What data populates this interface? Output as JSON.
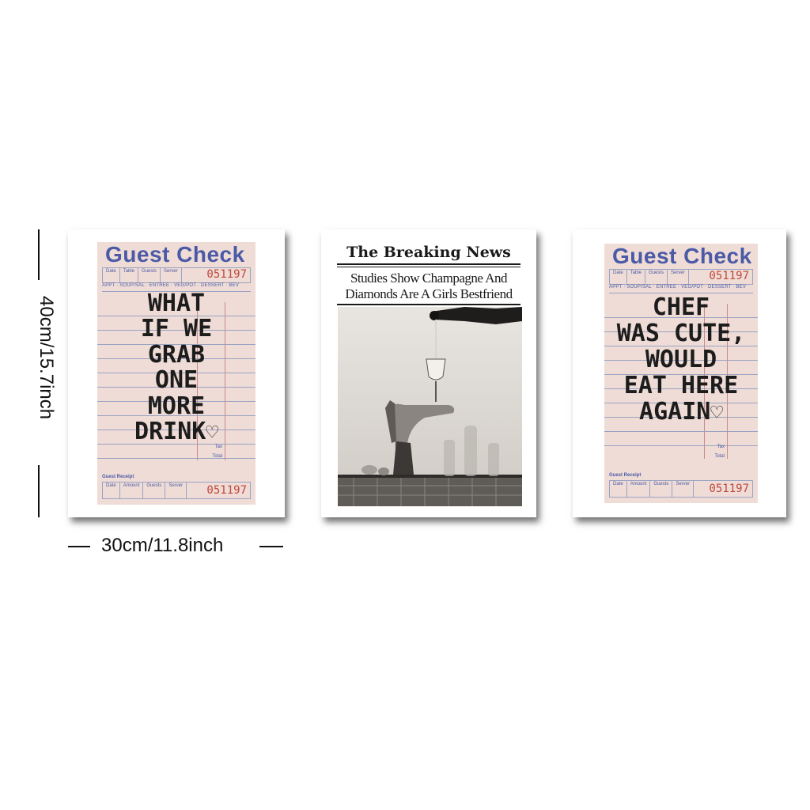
{
  "dimensions": {
    "height_label": "40cm/15.7inch",
    "width_label": "30cm/11.8inch"
  },
  "posters": [
    {
      "title": "Guest Check",
      "header_fields": [
        "Date",
        "Table",
        "Guests",
        "Server"
      ],
      "check_number": "051197",
      "course_row": "APPT · SOUP/SAL · ENTREE · VEG/POT · DESSERT · BEV",
      "handwritten_lines": [
        "WHAT",
        "IF WE",
        "GRAB",
        "ONE",
        "MORE",
        "DRINK"
      ],
      "tax_label": "Tax",
      "total_label": "Total",
      "receipt_label": "Guest Receipt",
      "receipt_fields": [
        "Date",
        "Amount",
        "Guests",
        "Server"
      ],
      "receipt_number": "051197"
    },
    {
      "masthead": "The Breaking News",
      "headline_line1": "Studies Show Champagne And",
      "headline_line2": "Diamonds Are A Girls Bestfriend"
    },
    {
      "title": "Guest Check",
      "header_fields": [
        "Date",
        "Table",
        "Guests",
        "Server"
      ],
      "check_number": "051197",
      "course_row": "APPT · SOUP/SAL · ENTREE · VEG/POT · DESSERT · BEV",
      "handwritten_lines": [
        "CHEF",
        "WAS CUTE,",
        "WOULD",
        "EAT HERE",
        "AGAIN"
      ],
      "tax_label": "Tax",
      "total_label": "Total",
      "receipt_label": "Guest Receipt",
      "receipt_fields": [
        "Date",
        "Amount",
        "Guests",
        "Server"
      ],
      "receipt_number": "051197"
    }
  ],
  "colors": {
    "check_paper": "#efdcd6",
    "check_ink_blue": "#4a5aa6",
    "check_number_red": "#c0473b"
  }
}
